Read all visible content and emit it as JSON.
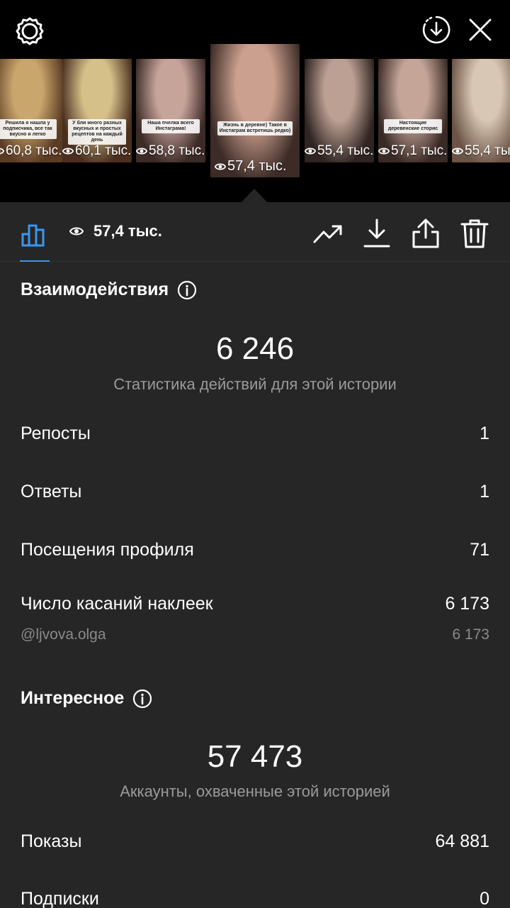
{
  "header": {
    "icons": {
      "settings": "gear-icon",
      "download": "download-circle-icon",
      "close": "close-icon"
    }
  },
  "stories": [
    {
      "views": "60,8 тыс.",
      "caption": "Решила я нашла у подписчика, все так вкусно и легко",
      "palette": [
        "#c9a66b",
        "#5a3b24"
      ],
      "selected": false
    },
    {
      "views": "60,1 тыс.",
      "caption": "У бли много разных вкусных и простых рецептов на каждый день",
      "palette": [
        "#d6c08a",
        "#4a2f1e"
      ],
      "selected": false
    },
    {
      "views": "58,8 тыс.",
      "caption": "Наша пчелка всего Инстаграма!",
      "palette": [
        "#c7a49a",
        "#3b2a26"
      ],
      "selected": false
    },
    {
      "views": "57,4 тыс.",
      "caption": "Жизнь в деревне) Такое в Инстаграм встретишь редко)",
      "palette": [
        "#cba08e",
        "#3c2b27"
      ],
      "selected": true
    },
    {
      "views": "55,4 тыс.",
      "caption": "",
      "palette": [
        "#bca093",
        "#2f2421"
      ],
      "selected": false
    },
    {
      "views": "57,1 тыс.",
      "caption": "Настоящие деревенские сторис",
      "palette": [
        "#c4a598",
        "#3a2a25"
      ],
      "selected": false
    },
    {
      "views": "55,4 тыс.",
      "caption": "",
      "palette": [
        "#d9c7b5",
        "#6b5446"
      ],
      "selected": false
    }
  ],
  "toolbar": {
    "views": "57,4 тыс.",
    "icons": [
      "bar-chart-icon",
      "eye-icon",
      "trend-icon",
      "download-icon",
      "share-icon",
      "trash-icon"
    ],
    "accent": "#3897f0"
  },
  "interactions": {
    "title": "Взаимодействия",
    "total": "6 246",
    "subtitle": "Статистика действий для этой истории",
    "rows": [
      {
        "label": "Репосты",
        "value": "1"
      },
      {
        "label": "Ответы",
        "value": "1"
      },
      {
        "label": "Посещения профиля",
        "value": "71"
      },
      {
        "label": "Число касаний наклеек",
        "value": "6 173"
      }
    ],
    "sticker": {
      "label": "@ljvova.olga",
      "value": "6 173"
    }
  },
  "discovery": {
    "title": "Интересное",
    "total": "57 473",
    "subtitle": "Аккаунты, охваченные этой историей",
    "rows": [
      {
        "label": "Показы",
        "value": "64 881"
      },
      {
        "label": "Подписки",
        "value": "0"
      }
    ]
  }
}
